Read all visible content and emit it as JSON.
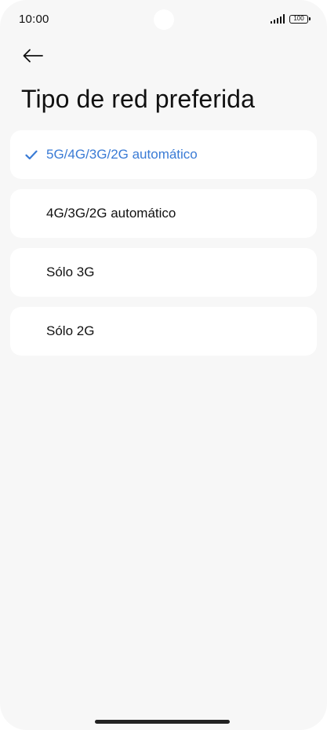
{
  "status_bar": {
    "time": "10:00",
    "battery": "100",
    "icons": [
      "signal-icon",
      "battery-icon"
    ]
  },
  "header": {
    "back_icon": "arrow-left-icon",
    "title": "Tipo de red preferida"
  },
  "options": [
    {
      "label": "5G/4G/3G/2G automático",
      "selected": true
    },
    {
      "label": "4G/3G/2G automático",
      "selected": false
    },
    {
      "label": "Sólo 3G",
      "selected": false
    },
    {
      "label": "Sólo 2G",
      "selected": false
    }
  ],
  "colors": {
    "accent": "#3a7bd5",
    "background": "#f7f7f7",
    "card": "#ffffff",
    "text": "#111111"
  }
}
